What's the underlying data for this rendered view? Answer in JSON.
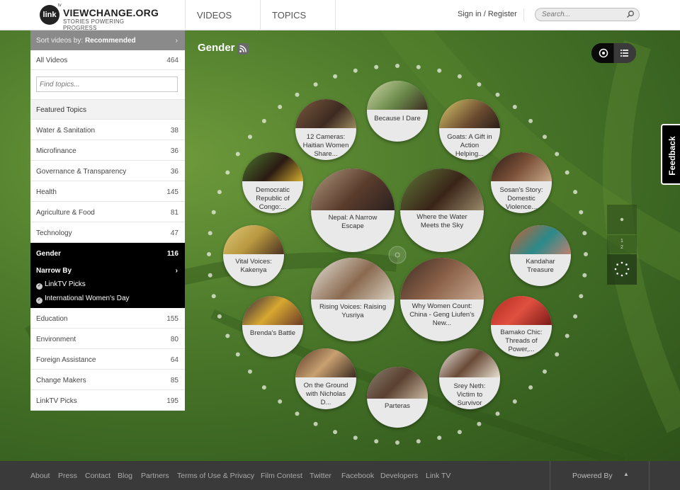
{
  "header": {
    "logo_badge": "link",
    "logo_tm": "tv",
    "logo_name": "VIEWCHANGE.ORG",
    "logo_tagline": "STORIES POWERING PROGRESS",
    "nav": [
      "VIDEOS",
      "TOPICS"
    ],
    "sign_in": "Sign in",
    "separator": "/",
    "register": "Register",
    "search_placeholder": "Search..."
  },
  "sidebar": {
    "sort_label": "Sort videos by:",
    "sort_value": "Recommended",
    "all_videos_label": "All Videos",
    "all_videos_count": "464",
    "find_placeholder": "Find topics...",
    "featured_heading": "Featured Topics",
    "topics_before": [
      {
        "label": "Water & Sanitation",
        "count": "38"
      },
      {
        "label": "Microfinance",
        "count": "36"
      },
      {
        "label": "Governance & Transparency",
        "count": "36"
      },
      {
        "label": "Health",
        "count": "145"
      },
      {
        "label": "Agriculture & Food",
        "count": "81"
      },
      {
        "label": "Technology",
        "count": "47"
      }
    ],
    "active_topic": {
      "label": "Gender",
      "count": "116"
    },
    "narrow_by": "Narrow By",
    "narrow_items": [
      "LinkTV Picks",
      "International Women's Day"
    ],
    "topics_after": [
      {
        "label": "Education",
        "count": "155"
      },
      {
        "label": "Environment",
        "count": "80"
      },
      {
        "label": "Foreign Assistance",
        "count": "64"
      },
      {
        "label": "Change Makers",
        "count": "85"
      },
      {
        "label": "LinkTV Picks",
        "count": "195"
      }
    ]
  },
  "page_title": "Gender",
  "videos": [
    "12 Cameras: Haitian Women Share...",
    "Because I Dare",
    "Goats: A Gift in Action Helping...",
    "Democratic Republic of Congo:...",
    "Nepal: A Narrow Escape",
    "Where the Water Meets the Sky",
    "Sosan's Story: Domestic Violence...",
    "Vital Voices: Kakenya",
    "Kandahar Treasure",
    "Rising Voices: Raising Yusriya",
    "Why Women Count: China - Geng Liufen's New...",
    "Brenda's Battle",
    "Bamako Chic: Threads of Power,...",
    "On the Ground with Nicholas D...",
    "Parteras",
    "Srey Neth: Victim to Survivor"
  ],
  "pager": {
    "page": "1",
    "total": "2"
  },
  "feedback": "Feedback",
  "footer": {
    "links": [
      "About",
      "Press",
      "Contact",
      "Blog",
      "Partners",
      "Terms of Use & Privacy",
      "Film Contest",
      "Twitter",
      "Facebook",
      "Developers",
      "Link TV"
    ],
    "powered_by": "Powered By"
  },
  "colors": {
    "accent_bg": "#3f6a26",
    "active_topic": "#000000",
    "footer": "#3a3a3a"
  },
  "icons": [
    "search-icon",
    "rss-icon",
    "circle-view-icon",
    "list-view-icon",
    "chevron-right-icon",
    "loading-icon",
    "chevron-up-icon"
  ]
}
